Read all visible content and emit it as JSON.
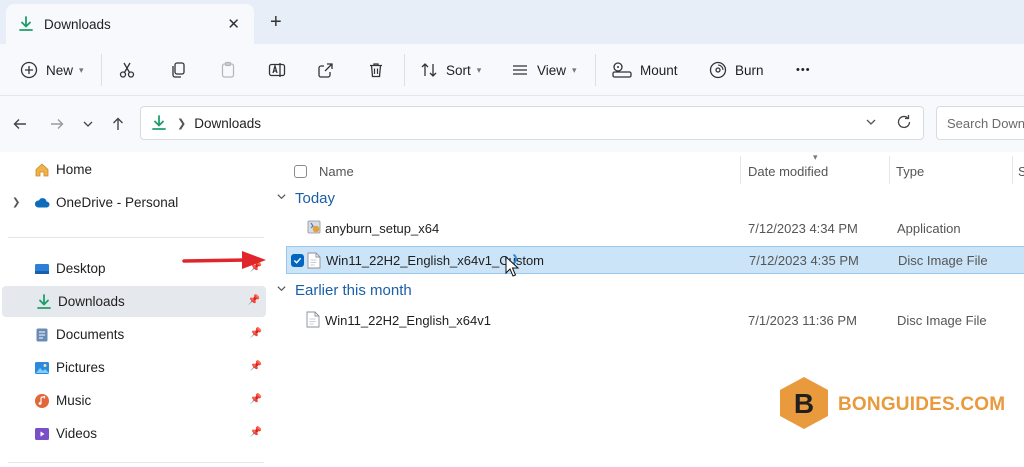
{
  "tab": {
    "title": "Downloads",
    "close_glyph": "✕",
    "new_tab_glyph": "+"
  },
  "toolbar": {
    "new_label": "New",
    "sort_label": "Sort",
    "view_label": "View",
    "mount_label": "Mount",
    "burn_label": "Burn",
    "more_glyph": "•••"
  },
  "address": {
    "crumb": "Downloads",
    "search_placeholder": "Search Downlo"
  },
  "sidebar": {
    "items": [
      {
        "label": "Home"
      },
      {
        "label": "OneDrive - Personal"
      },
      {
        "label": "Desktop"
      },
      {
        "label": "Downloads"
      },
      {
        "label": "Documents"
      },
      {
        "label": "Pictures"
      },
      {
        "label": "Music"
      },
      {
        "label": "Videos"
      }
    ]
  },
  "columns": {
    "name": "Name",
    "date": "Date modified",
    "type": "Type",
    "size": "S"
  },
  "groups": [
    {
      "label": "Today",
      "rows": [
        {
          "name": "anyburn_setup_x64",
          "date": "7/12/2023 4:34 PM",
          "type": "Application",
          "size": ""
        },
        {
          "name": "Win11_22H2_English_x64v1_Custom",
          "date": "7/12/2023 4:35 PM",
          "type": "Disc Image File",
          "size": ""
        }
      ]
    },
    {
      "label": "Earlier this month",
      "rows": [
        {
          "name": "Win11_22H2_English_x64v1",
          "date": "7/1/2023 11:36 PM",
          "type": "Disc Image File",
          "size": ""
        }
      ]
    }
  ],
  "watermark": {
    "text": "BONGUIDES.COM",
    "letter": "B"
  },
  "colors": {
    "accent": "#0067c0",
    "folder_green": "#1e9e6a",
    "group_blue": "#1a5fa8",
    "watermark": "#e89a3c"
  }
}
